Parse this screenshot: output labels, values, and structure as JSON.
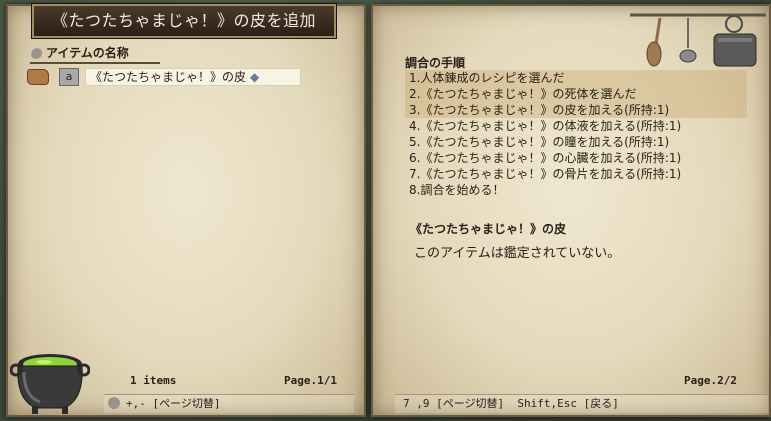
{
  "left_panel": {
    "title": "《たつたちゃまじゃ！》の皮を追加",
    "section_header": "アイテムの名称",
    "item": {
      "key": "a",
      "name": "《たつたちゃまじゃ！》の皮",
      "gem_glyph": "◆"
    },
    "count": "1 items",
    "page": "Page.1/1",
    "hint": "+,- [ページ切替]"
  },
  "right_panel": {
    "recipe_header": "調合の手順",
    "steps": [
      "1.人体錬成のレシピを選んだ",
      "2.《たつたちゃまじゃ！》の死体を選んだ",
      "3.《たつたちゃまじゃ！》の皮を加える(所持:1)",
      "4.《たつたちゃまじゃ！》の体液を加える(所持:1)",
      "5.《たつたちゃまじゃ！》の瞳を加える(所持:1)",
      "6.《たつたちゃまじゃ！》の心臓を加える(所持:1)",
      "7.《たつたちゃまじゃ！》の骨片を加える(所持:1)",
      "8.調合を始める！"
    ],
    "item_title": "《たつたちゃまじゃ！》の皮",
    "item_desc": "このアイテムは鑑定されていない。",
    "page": "Page.2/2",
    "hint": "7 ,9 [ページ切替]  Shift,Esc [戻る]"
  },
  "colors": {
    "parchment": "#e4d9bb",
    "title_bar": "#2a1f17",
    "highlight": "#c4a064",
    "cauldron_liquid": "#8fd43a"
  }
}
